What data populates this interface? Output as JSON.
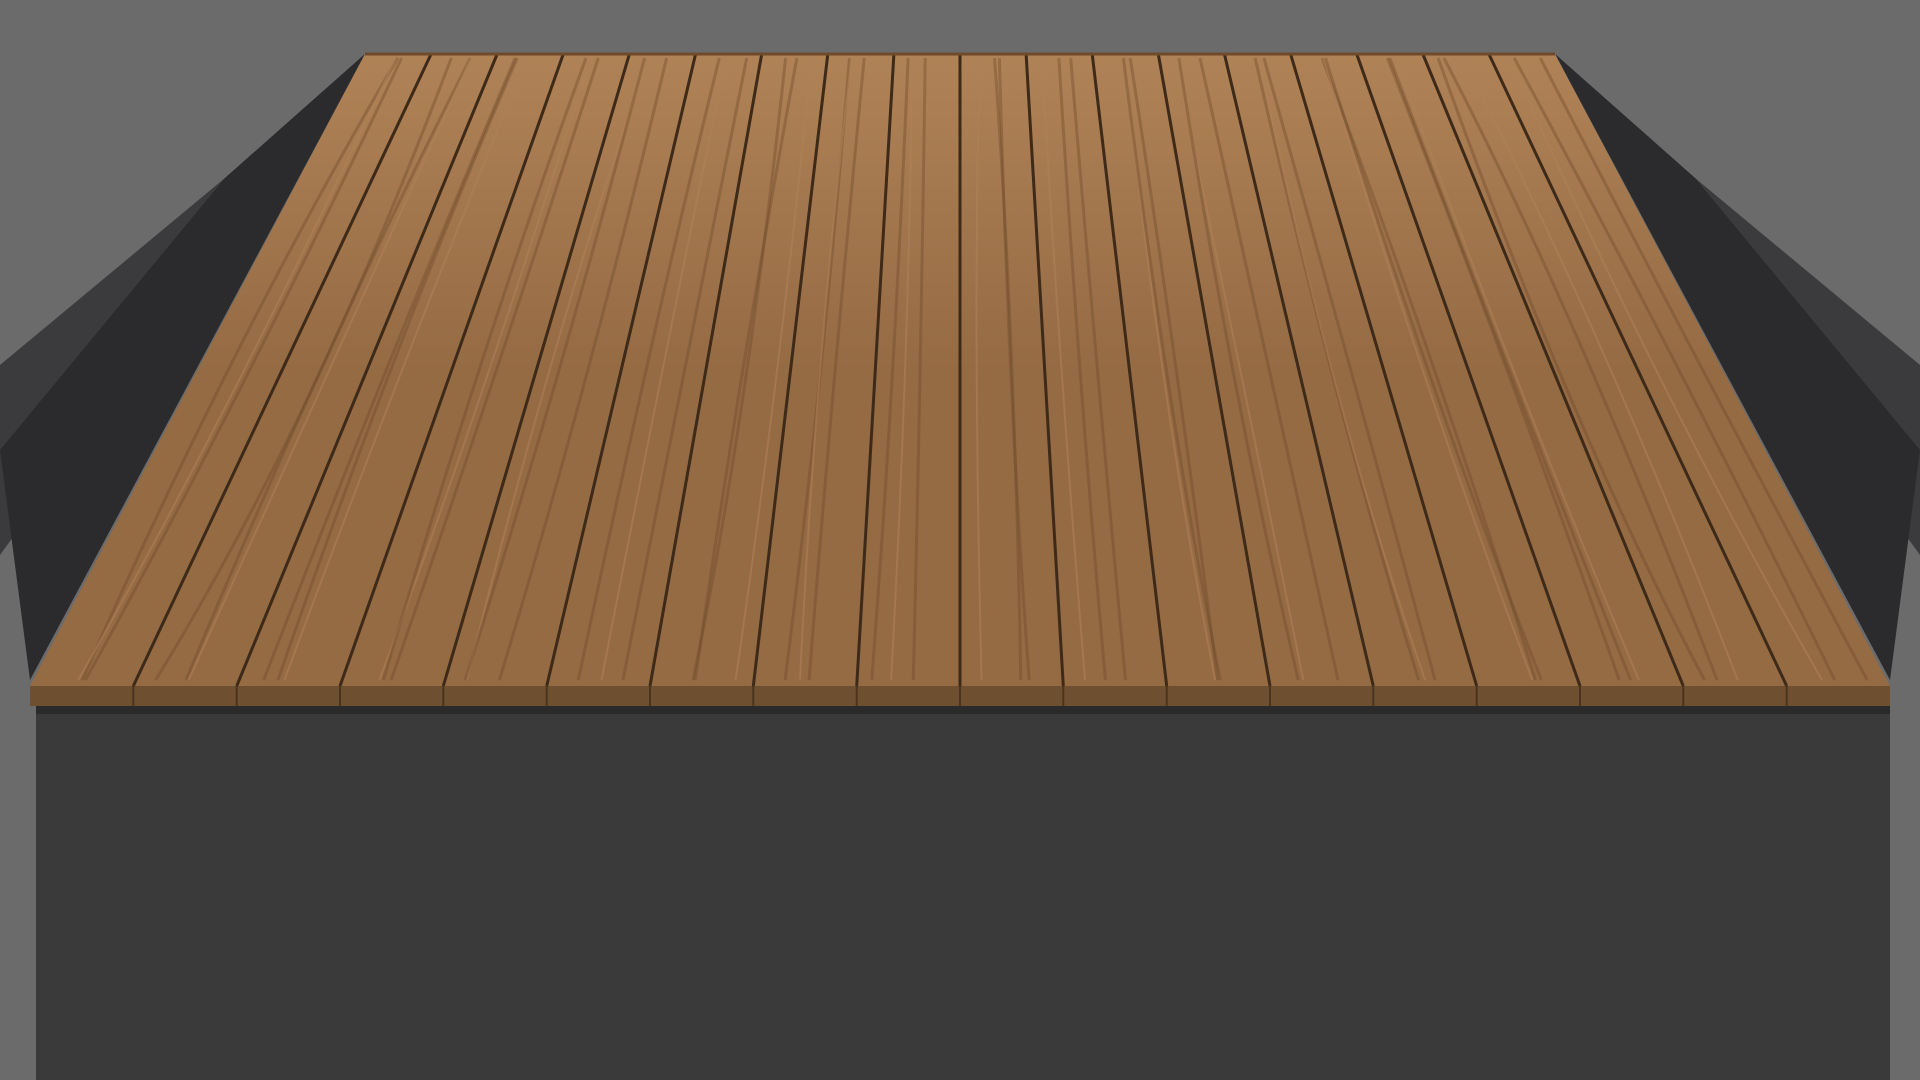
{
  "scene": {
    "name": "wooden-deck-platform",
    "plank_count": 18
  },
  "colors": {
    "background": "#6b6b6b",
    "slope_dark": "#2b2b2d",
    "slope_mid": "#3b3b3d",
    "slope_light": "#4a4a4c",
    "wall": "#3a3a3a",
    "wall_shadow": "#2a2a2a",
    "wood_base": "#956b44",
    "wood_light": "#b08257",
    "wood_dark": "#6f4b2b",
    "wood_gap": "#3d2a18",
    "plank_edge": "#6e5030",
    "plank_edge_divider": "#4a341d"
  }
}
